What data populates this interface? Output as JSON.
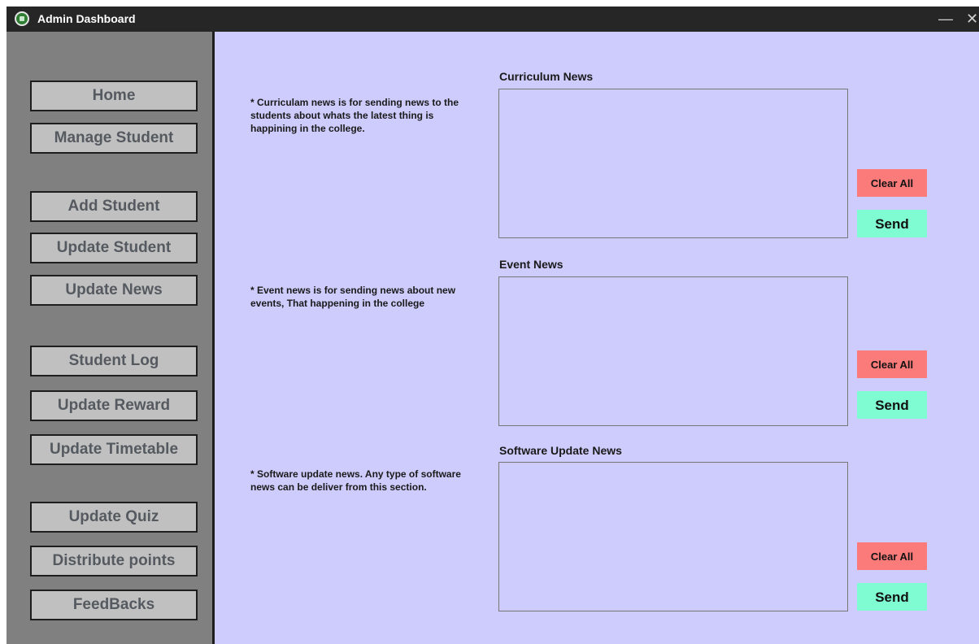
{
  "window": {
    "title": "Admin Dashboard",
    "minimize_glyph": "—",
    "close_glyph": "✕"
  },
  "sidebar": {
    "items": [
      {
        "label": "Home"
      },
      {
        "label": "Manage Student"
      },
      {
        "label": "Add Student"
      },
      {
        "label": "Update Student"
      },
      {
        "label": "Update News"
      },
      {
        "label": "Student Log"
      },
      {
        "label": "Update Reward"
      },
      {
        "label": "Update Timetable"
      },
      {
        "label": "Update Quiz"
      },
      {
        "label": "Distribute points"
      },
      {
        "label": "FeedBacks"
      }
    ]
  },
  "sections": [
    {
      "title": "Curriculum News",
      "description": "* Curriculam news is for sending news to the students about whats the latest thing is happining in the college.",
      "text": "",
      "clear_label": "Clear All",
      "send_label": "Send"
    },
    {
      "title": "Event News",
      "description": "* Event news is for sending news about new events, That happening in the college",
      "text": "",
      "clear_label": "Clear All",
      "send_label": "Send"
    },
    {
      "title": "Software Update News",
      "description": "* Software update news. Any type of software news can be deliver from this section.",
      "text": "",
      "clear_label": "Clear All",
      "send_label": "Send"
    }
  ],
  "colors": {
    "content_bg": "#cdccfc",
    "sidebar_bg": "#808080",
    "titlebar_bg": "#262626",
    "clear_button": "#fb7b7b",
    "send_button": "#7ffcd1"
  }
}
